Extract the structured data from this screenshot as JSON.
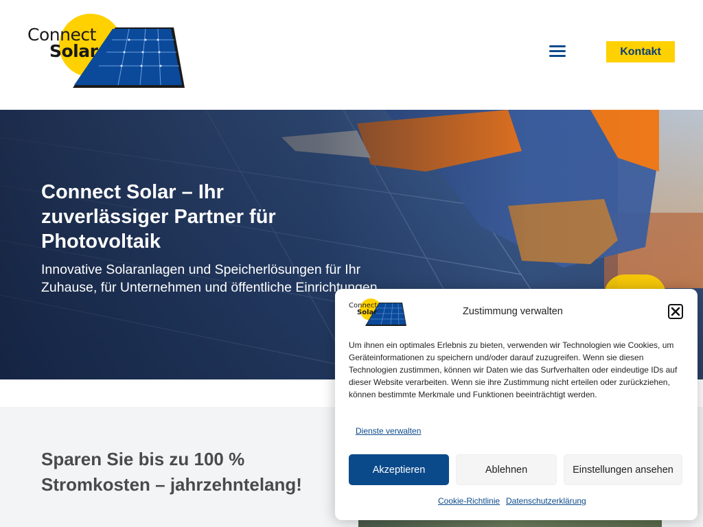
{
  "header": {
    "logo_line1": "Connect",
    "logo_line2": "Solar",
    "menu_icon": "hamburger-menu-icon",
    "contact_label": "Kontakt"
  },
  "hero": {
    "title": "Connect Solar – Ihr zuverlässiger Partner für Photovoltaik",
    "subtitle": "Innovative Solaranlagen und Speicherlösungen für Ihr Zuhause, für Unternehmen und öffentliche Einrichtungen"
  },
  "section": {
    "title": "Sparen Sie bis zu 100 % Stromkosten – jahrzehntelang!"
  },
  "consent": {
    "logo_line1": "Connect",
    "logo_line2": "Solar",
    "title": "Zustimmung verwalten",
    "close_icon": "close-icon",
    "text": "Um ihnen ein optimales Erlebnis zu bieten, verwenden wir Technologien wie Cookies, um Geräteinformationen zu speichern und/oder darauf zuzugreifen. Wenn sie diesen Technologien zustimmen, können wir Daten wie das Surfverhalten oder eindeutige IDs auf dieser Website verarbeiten. Wenn sie ihre Zustimmung nicht erteilen oder zurückziehen, können bestimmte Merkmale und Funktionen beeinträchtigt werden.",
    "manage_services": "Dienste verwalten",
    "accept_label": "Akzeptieren",
    "deny_label": "Ablehnen",
    "settings_label": "Einstellungen ansehen",
    "cookie_policy": "Cookie-Richtlinie",
    "privacy_policy": "Datenschutzerklärung"
  },
  "colors": {
    "brand_blue": "#0b4a8a",
    "brand_yellow": "#ffd100",
    "section_bg": "#f3f4f6"
  }
}
